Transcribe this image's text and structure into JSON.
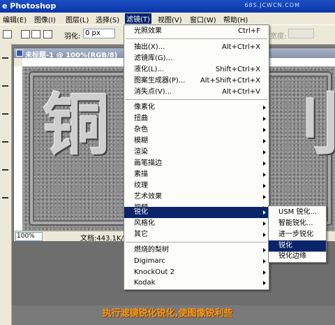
{
  "app": {
    "title": "e Photoshop",
    "watermark": "68S.JCWCN.COM"
  },
  "menubar": {
    "items": [
      "编辑(E)",
      "图像(I)",
      "图层(L)",
      "选择(S)",
      "滤镜(T)",
      "视图(V)",
      "窗口(W)",
      "帮助(H)"
    ],
    "active_index": 4
  },
  "options": {
    "feather_label": "羽化:",
    "feather_value": "0 px",
    "width_label": "宽度:"
  },
  "document": {
    "title": "未标题-1 @ 100%(RGB/8)",
    "zoom": "100%",
    "doc_info": "文档:443.1K/",
    "glyphs": [
      "铜",
      "刂"
    ]
  },
  "filter_menu": {
    "items": [
      {
        "label": "光照效果",
        "shortcut": "Ctrl+F"
      },
      {
        "label": "抽出(X)...",
        "shortcut": "Alt+Ctrl+X"
      },
      {
        "label": "滤镜库(G)..."
      },
      {
        "label": "液化(L)...",
        "shortcut": "Shift+Ctrl+X"
      },
      {
        "label": "图案生成器(P)...",
        "shortcut": "Alt+Shift+Ctrl+X"
      },
      {
        "label": "消失点(V)...",
        "shortcut": "Alt+Ctrl+V"
      },
      {
        "label": "像素化",
        "submenu": true
      },
      {
        "label": "扭曲",
        "submenu": true
      },
      {
        "label": "杂色",
        "submenu": true
      },
      {
        "label": "模糊",
        "submenu": true
      },
      {
        "label": "渲染",
        "submenu": true
      },
      {
        "label": "画笔描边",
        "submenu": true
      },
      {
        "label": "素描",
        "submenu": true
      },
      {
        "label": "纹理",
        "submenu": true
      },
      {
        "label": "艺术效果",
        "submenu": true
      },
      {
        "label": "视频",
        "submenu": true
      },
      {
        "label": "锐化",
        "submenu": true,
        "highlighted": true
      },
      {
        "label": "风格化",
        "submenu": true
      },
      {
        "label": "其它",
        "submenu": true
      },
      {
        "label": "燃烧的梨树",
        "submenu": true
      },
      {
        "label": "Digimarc",
        "submenu": true
      },
      {
        "label": "KnockOut 2",
        "submenu": true
      },
      {
        "label": "Kodak",
        "submenu": true
      }
    ]
  },
  "sharpen_submenu": {
    "items": [
      {
        "label": "USM 锐化..."
      },
      {
        "label": "智能锐化..."
      },
      {
        "label": "进一步锐化"
      },
      {
        "label": "锐化",
        "highlighted": true
      },
      {
        "label": "锐化边缘"
      }
    ]
  },
  "caption": "执行滤镜锐化锐化,使图像锐利些",
  "colors": {
    "menu_highlight": "#0a246a",
    "caption": "#f39c1f",
    "titlebar": "#0a36a8"
  }
}
